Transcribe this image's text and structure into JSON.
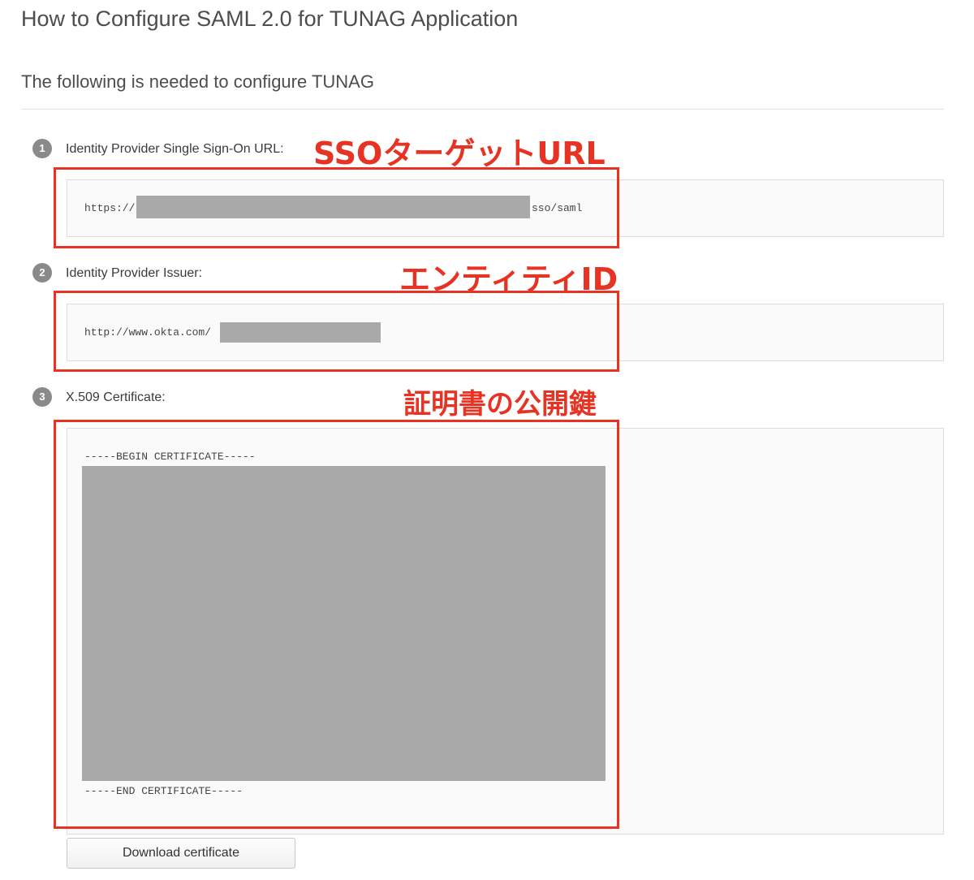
{
  "page": {
    "title": "How to Configure SAML 2.0 for TUNAG Application",
    "subtitle": "The following is needed to configure TUNAG"
  },
  "steps": [
    {
      "number": "1",
      "label": "Identity Provider Single Sign-On URL:",
      "value_prefix": "https://",
      "value_suffix": "sso/saml",
      "annotation": "SSOターゲットURL"
    },
    {
      "number": "2",
      "label": "Identity Provider Issuer:",
      "value_prefix": "http://www.okta.com/",
      "annotation": "エンティティID"
    },
    {
      "number": "3",
      "label": "X.509 Certificate:",
      "cert_begin": "-----BEGIN CERTIFICATE-----",
      "cert_end": "-----END CERTIFICATE-----",
      "annotation": "証明書の公開鍵"
    }
  ],
  "download_button": "Download certificate",
  "colors": {
    "annotation_red": "#e63323",
    "redaction_gray": "#a9a9a9",
    "field_bg": "#fafafa"
  }
}
